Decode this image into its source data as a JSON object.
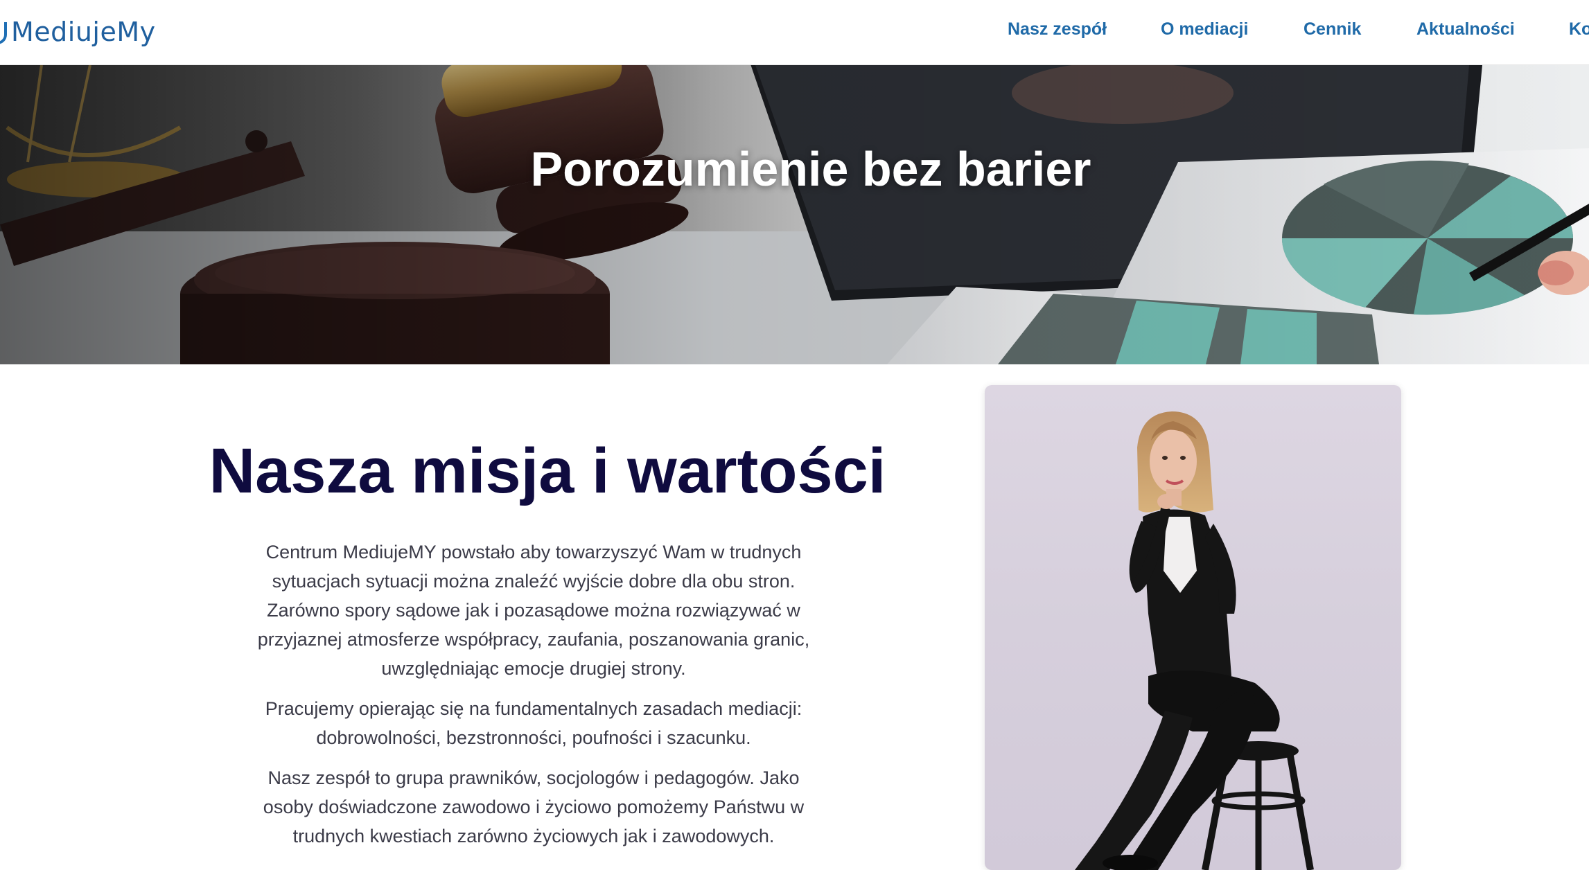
{
  "header": {
    "logo_text": "MediujeMy",
    "nav": [
      {
        "label": "Nasz zespół"
      },
      {
        "label": "O mediacji"
      },
      {
        "label": "Cennik"
      },
      {
        "label": "Aktualności"
      },
      {
        "label": "Ko"
      }
    ]
  },
  "hero": {
    "title": "Porozumienie bez barier"
  },
  "mission": {
    "title": "Nasza misja i wartości",
    "paragraphs": [
      "Centrum MediujeMY powstało aby towarzyszyć Wam w trudnych sytuacjach sytuacji można znaleźć wyjście dobre dla obu stron. Zarówno spory sądowe jak i pozasądowe można rozwiązywać w przyjaznej atmosferze współpracy, zaufania, poszanowania granic, uwzględniając emocje drugiej strony.",
      "Pracujemy opierając się na fundamentalnych zasadach mediacji: dobrowolności, bezstronności, poufności i szacunku.",
      "Nasz zespół to grupa prawników, socjologów i pedagogów. Jako osoby doświadczone zawodowo i życiowo pomożemy Państwu w trudnych kwestiach zarówno życiowych jak i zawodowych."
    ]
  },
  "colors": {
    "nav": "#1f6aa8",
    "title": "#0f0b3f",
    "body_text": "#3b3b48"
  }
}
